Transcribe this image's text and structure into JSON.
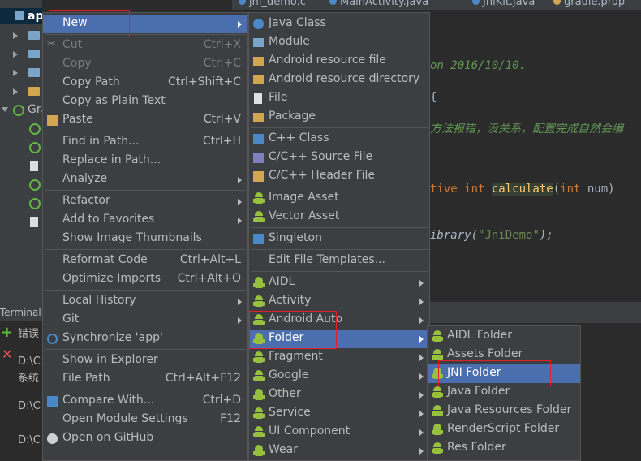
{
  "ide": {
    "tabs": [
      "jni_demo.c",
      "MainActivity.java",
      "JniKit.java",
      "gradle.prop"
    ],
    "project_root_label": "ap",
    "gradle_label": "Gra",
    "terminal_title": "Terminal",
    "terminal_lines": [
      "错误",
      "D:\\C",
      "系统",
      "D:\\C",
      "D:\\C"
    ],
    "code_lines": [
      {
        "text": "on 2016/10/10.",
        "color": "#629755"
      },
      {
        "text": "{",
        "color": "#a9b7c6"
      },
      {
        "text": "方法报错，没关系，配置完成自然会编",
        "color": "#629755"
      },
      {
        "text": "tive int calculate(int num)",
        "color": "#cc7832"
      },
      {
        "text": "ibrary(\"JniDemo\");",
        "color": "#a9b7c6"
      }
    ]
  },
  "context_menu": {
    "items": [
      {
        "label": "New",
        "shortcut": "",
        "submenu": true,
        "selected": true
      },
      {
        "label": "Cut",
        "shortcut": "Ctrl+X",
        "disabled": true,
        "icon": "scissors-icon"
      },
      {
        "label": "Copy",
        "shortcut": "Ctrl+C",
        "disabled": true
      },
      {
        "label": "Copy Path",
        "shortcut": "Ctrl+Shift+C"
      },
      {
        "label": "Copy as Plain Text",
        "shortcut": ""
      },
      {
        "label": "Paste",
        "shortcut": "Ctrl+V",
        "icon": "paste-icon"
      },
      {
        "label": "Find in Path...",
        "shortcut": "Ctrl+H"
      },
      {
        "label": "Replace in Path...",
        "shortcut": ""
      },
      {
        "label": "Analyze",
        "shortcut": "",
        "submenu": true
      },
      {
        "label": "Refactor",
        "shortcut": "",
        "submenu": true
      },
      {
        "label": "Add to Favorites",
        "shortcut": "",
        "submenu": true
      },
      {
        "label": "Show Image Thumbnails",
        "shortcut": ""
      },
      {
        "label": "Reformat Code",
        "shortcut": "Ctrl+Alt+L"
      },
      {
        "label": "Optimize Imports",
        "shortcut": "Ctrl+Alt+O"
      },
      {
        "label": "Local History",
        "shortcut": "",
        "submenu": true
      },
      {
        "label": "Git",
        "shortcut": "",
        "submenu": true
      },
      {
        "label": "Synchronize 'app'",
        "shortcut": "",
        "icon": "sync-icon"
      },
      {
        "label": "Show in Explorer",
        "shortcut": ""
      },
      {
        "label": "File Path",
        "shortcut": "Ctrl+Alt+F12"
      },
      {
        "label": "Compare With...",
        "shortcut": "Ctrl+D",
        "icon": "compare-icon"
      },
      {
        "label": "Open Module Settings",
        "shortcut": "F12"
      },
      {
        "label": "Open on GitHub",
        "shortcut": "",
        "icon": "github-icon"
      }
    ]
  },
  "new_submenu": {
    "items": [
      {
        "label": "Java Class",
        "icon": "java-class-icon"
      },
      {
        "label": "Module",
        "icon": "module-icon"
      },
      {
        "label": "Android resource file",
        "icon": "resource-file-icon"
      },
      {
        "label": "Android resource directory",
        "icon": "folder-icon"
      },
      {
        "label": "File",
        "icon": "file-icon"
      },
      {
        "label": "Package",
        "icon": "package-icon"
      },
      {
        "label": "C++ Class",
        "icon": "cpp-class-icon"
      },
      {
        "label": "C/C++ Source File",
        "icon": "cpp-source-icon"
      },
      {
        "label": "C/C++ Header File",
        "icon": "cpp-header-icon"
      },
      {
        "label": "Image Asset",
        "icon": "android-icon"
      },
      {
        "label": "Vector Asset",
        "icon": "android-icon"
      },
      {
        "label": "Singleton",
        "icon": "singleton-icon"
      },
      {
        "label": "Edit File Templates...",
        "icon": ""
      },
      {
        "label": "AIDL",
        "icon": "android-icon",
        "submenu": true
      },
      {
        "label": "Activity",
        "icon": "android-icon",
        "submenu": true
      },
      {
        "label": "Android Auto",
        "icon": "android-icon",
        "submenu": true
      },
      {
        "label": "Folder",
        "icon": "android-icon",
        "submenu": true,
        "selected": true
      },
      {
        "label": "Fragment",
        "icon": "android-icon",
        "submenu": true
      },
      {
        "label": "Google",
        "icon": "android-icon",
        "submenu": true
      },
      {
        "label": "Other",
        "icon": "android-icon",
        "submenu": true
      },
      {
        "label": "Service",
        "icon": "android-icon",
        "submenu": true
      },
      {
        "label": "UI Component",
        "icon": "android-icon",
        "submenu": true
      },
      {
        "label": "Wear",
        "icon": "android-icon",
        "submenu": true
      }
    ]
  },
  "folder_submenu": {
    "items": [
      {
        "label": "AIDL Folder"
      },
      {
        "label": "Assets Folder"
      },
      {
        "label": "JNI Folder",
        "selected": true
      },
      {
        "label": "Java Folder"
      },
      {
        "label": "Java Resources Folder"
      },
      {
        "label": "RenderScript Folder"
      },
      {
        "label": "Res Folder"
      }
    ]
  },
  "colors": {
    "menu_bg": "#3c3f41",
    "selection": "#4b6eaf",
    "highlight_box": "#e3202a",
    "android_green": "#97c03e"
  }
}
